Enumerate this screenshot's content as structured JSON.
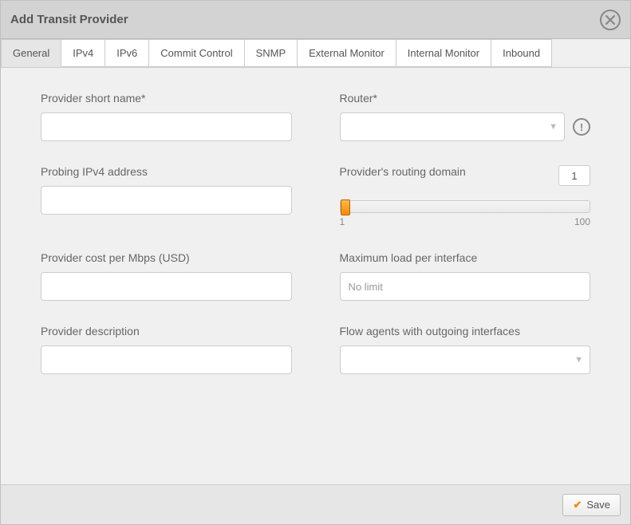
{
  "dialog": {
    "title": "Add Transit Provider"
  },
  "tabs": [
    {
      "label": "General",
      "active": true
    },
    {
      "label": "IPv4",
      "active": false
    },
    {
      "label": "IPv6",
      "active": false
    },
    {
      "label": "Commit Control",
      "active": false
    },
    {
      "label": "SNMP",
      "active": false
    },
    {
      "label": "External Monitor",
      "active": false
    },
    {
      "label": "Internal Monitor",
      "active": false
    },
    {
      "label": "Inbound",
      "active": false
    }
  ],
  "fields": {
    "short_name": {
      "label": "Provider short name*",
      "value": ""
    },
    "probing_ipv4": {
      "label": "Probing IPv4 address",
      "value": ""
    },
    "cost": {
      "label": "Provider cost per Mbps (USD)",
      "value": ""
    },
    "description": {
      "label": "Provider description",
      "value": ""
    },
    "router": {
      "label": "Router*",
      "value": "",
      "selected": ""
    },
    "routing_domain": {
      "label": "Provider's routing domain",
      "value": "1",
      "min": "1",
      "max": "100"
    },
    "max_load": {
      "label": "Maximum load per interface",
      "value": "",
      "placeholder": "No limit"
    },
    "flow_agents": {
      "label": "Flow agents with outgoing interfaces",
      "selected": ""
    }
  },
  "footer": {
    "save_label": "Save"
  }
}
